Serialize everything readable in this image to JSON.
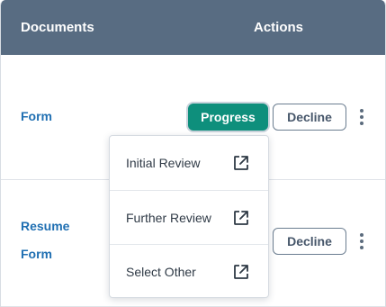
{
  "table": {
    "headers": {
      "documents": "Documents",
      "actions": "Actions"
    },
    "rows": [
      {
        "document": "Form",
        "progress_label": "Progress",
        "decline_label": "Decline"
      },
      {
        "document": "Resume Form",
        "decline_label": "Decline"
      }
    ]
  },
  "dropdown": {
    "items": [
      {
        "label": "Initial Review",
        "icon": "external-link-icon"
      },
      {
        "label": "Further Review",
        "icon": "external-link-icon"
      },
      {
        "label": "Select Other",
        "icon": "external-link-icon"
      }
    ]
  },
  "colors": {
    "header_bg": "#586c82",
    "progress_bg": "#0e8f7c",
    "link": "#1f6fb2"
  }
}
